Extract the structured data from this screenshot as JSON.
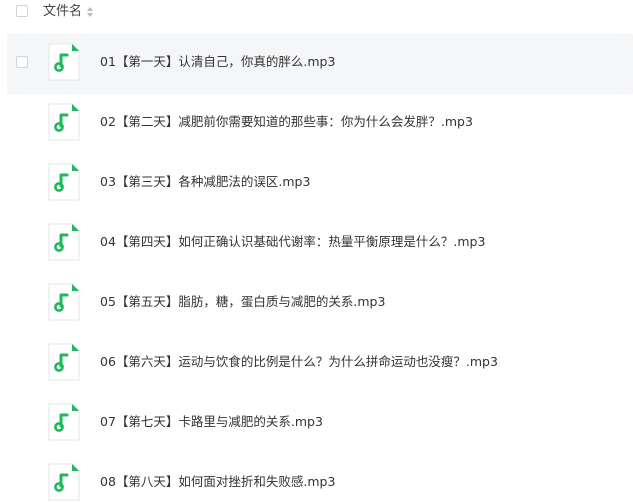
{
  "header": {
    "name_label": "文件名"
  },
  "colors": {
    "accent": "#1fb85c",
    "hover_row_bg": "#f5f6f8"
  },
  "icons": {
    "file": "music-file-icon",
    "sort": "sort-icon"
  },
  "files": [
    {
      "name": "01【第一天】认清自己，你真的胖么.mp3",
      "hovered": true
    },
    {
      "name": "02【第二天】减肥前你需要知道的那些事：你为什么会发胖？.mp3",
      "hovered": false
    },
    {
      "name": "03【第三天】各种减肥法的误区.mp3",
      "hovered": false
    },
    {
      "name": "04【第四天】如何正确认识基础代谢率：热量平衡原理是什么？.mp3",
      "hovered": false
    },
    {
      "name": "05【第五天】脂肪，糖，蛋白质与减肥的关系.mp3",
      "hovered": false
    },
    {
      "name": "06【第六天】运动与饮食的比例是什么？为什么拼命运动也没瘦？.mp3",
      "hovered": false
    },
    {
      "name": "07【第七天】卡路里与减肥的关系.mp3",
      "hovered": false
    },
    {
      "name": "08【第八天】如何面对挫折和失败感.mp3",
      "hovered": false
    }
  ]
}
